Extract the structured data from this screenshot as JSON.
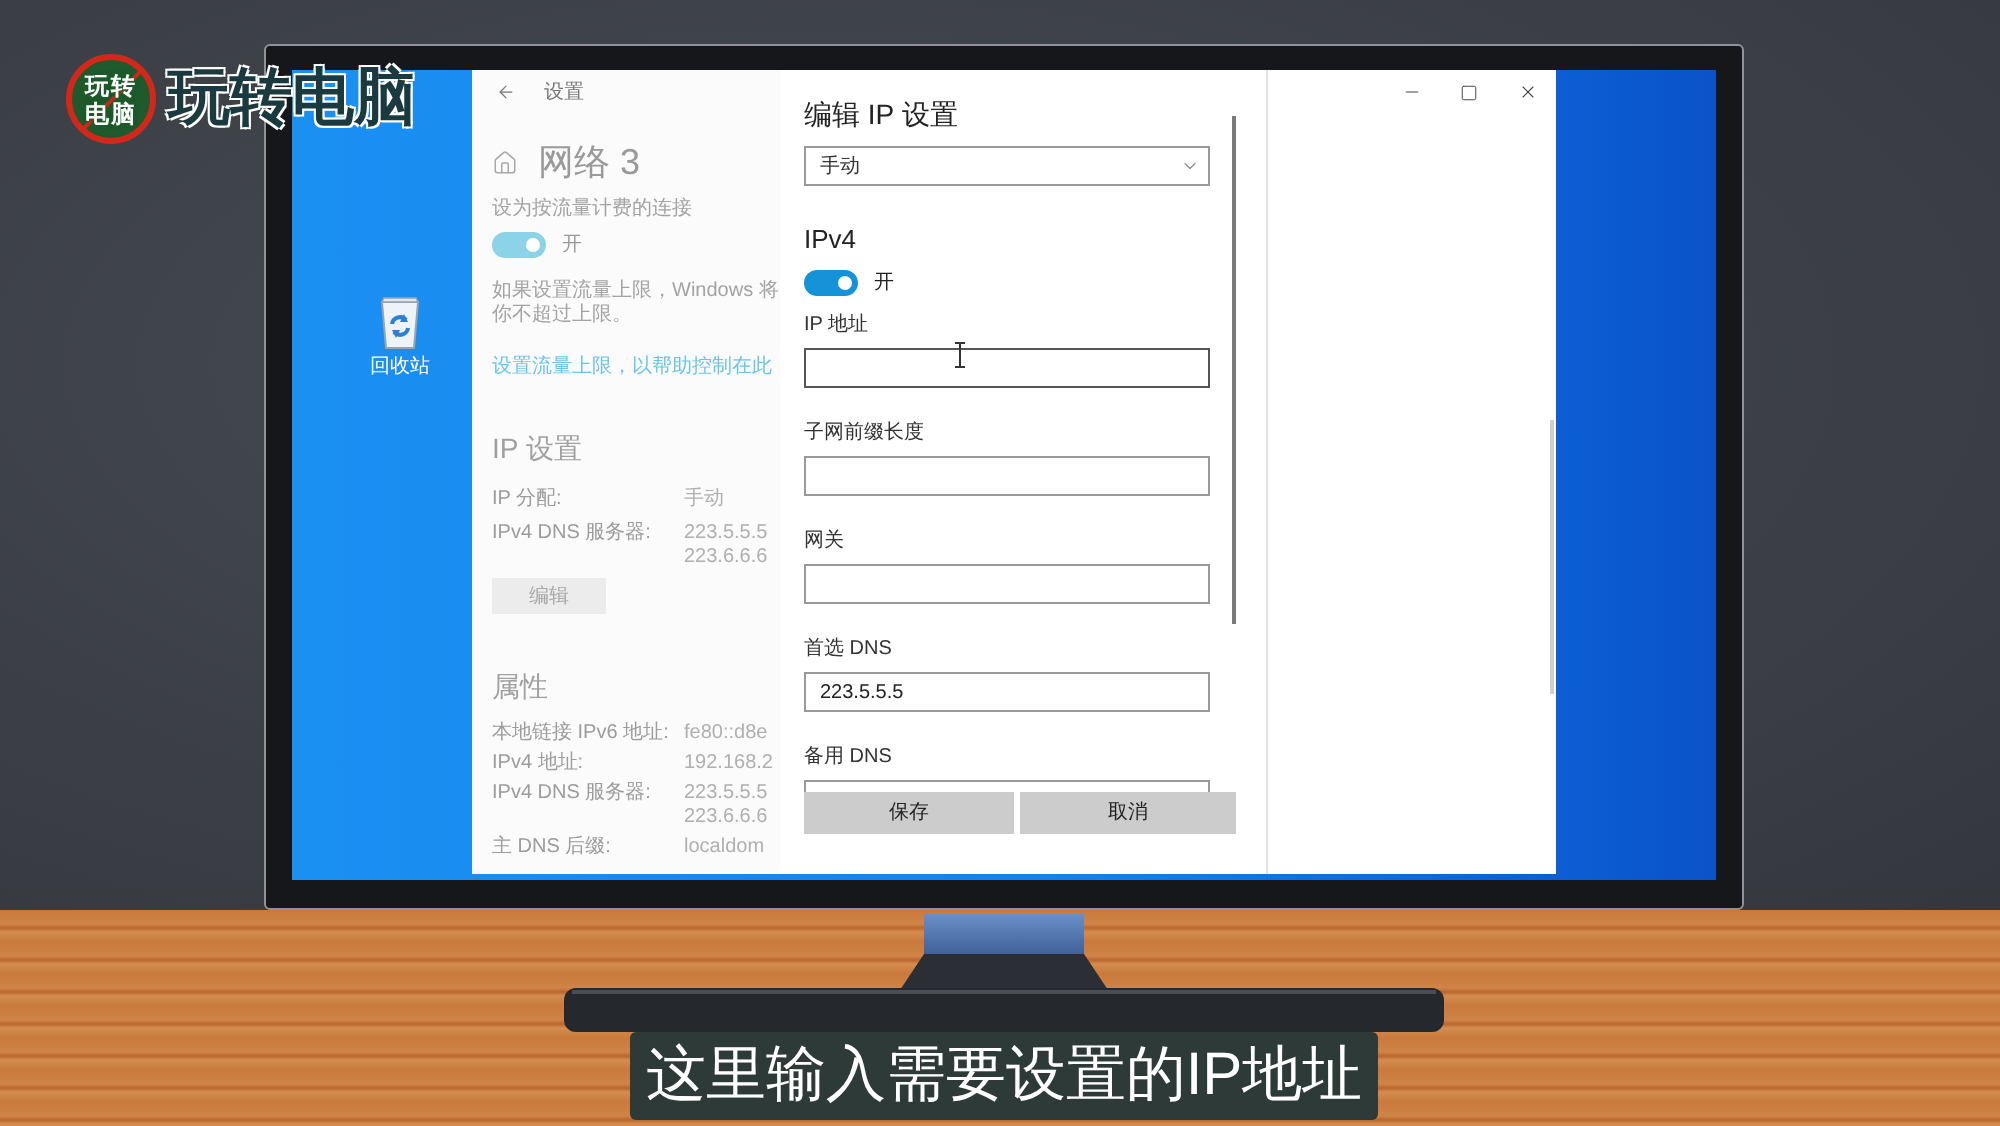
{
  "logo": {
    "badge_lines": [
      "玩转",
      "电脑"
    ],
    "title": "玩转电脑"
  },
  "desktop": {
    "icons": [
      {
        "label": "回收站"
      }
    ]
  },
  "settings_window": {
    "title": "设置",
    "page": {
      "title": "网络 3",
      "metered": {
        "label": "设为按流量计费的连接",
        "toggle": {
          "on": true,
          "label": "开"
        }
      },
      "note_lines": [
        "如果设置流量上限，Windows 将",
        "你不超过上限。"
      ],
      "link": "设置流量上限，以帮助控制在此",
      "ip_settings": {
        "heading": "IP 设置",
        "rows": [
          {
            "label": "IP 分配:",
            "values": [
              "手动"
            ]
          },
          {
            "label": "IPv4 DNS 服务器:",
            "values": [
              "223.5.5.5",
              "223.6.6.6"
            ]
          }
        ],
        "button": "编辑"
      },
      "properties": {
        "heading": "属性",
        "rows": [
          {
            "label": "本地链接 IPv6 地址:",
            "values": [
              "fe80::d8e"
            ]
          },
          {
            "label": "IPv4 地址:",
            "values": [
              "192.168.2"
            ]
          },
          {
            "label": "IPv4 DNS 服务器:",
            "values": [
              "223.5.5.5",
              "223.6.6.6"
            ]
          },
          {
            "label": "主 DNS 后缀:",
            "values": [
              "localdom"
            ]
          }
        ]
      }
    }
  },
  "dialog": {
    "title": "编辑 IP 设置",
    "dropdown": {
      "value": "手动"
    },
    "section": "IPv4",
    "toggle": {
      "on": true,
      "label": "开"
    },
    "fields": [
      {
        "label": "IP 地址",
        "hovered": true
      },
      {
        "label": "子网前缀长度",
        "hovered": false
      },
      {
        "label": "网关",
        "hovered": false
      },
      {
        "label": "首选 DNS",
        "value": "223.5.5.5",
        "hovered": false
      },
      {
        "label": "备用 DNS",
        "hovered": false
      }
    ],
    "buttons": [
      {
        "label": "保存"
      },
      {
        "label": "取消"
      }
    ]
  },
  "subtitle": "这里输入需要设置的IP地址"
}
